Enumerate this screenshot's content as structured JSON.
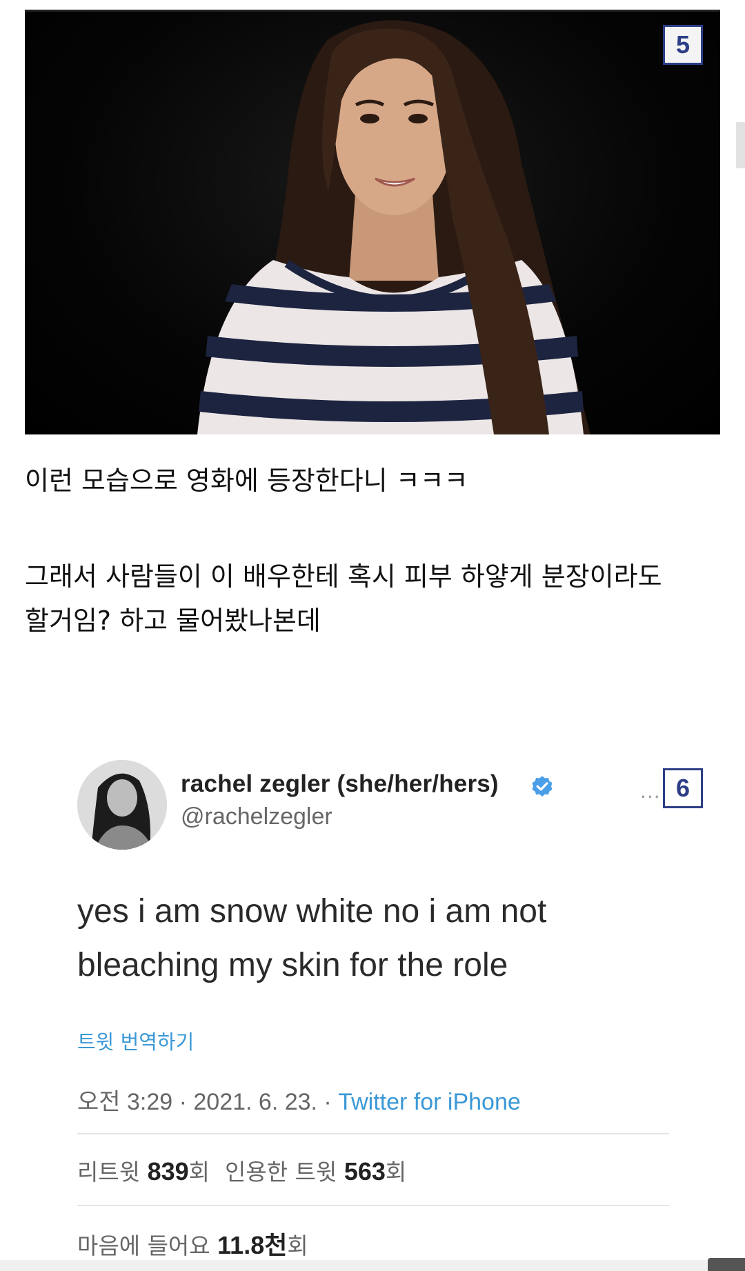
{
  "badges": {
    "first": "5",
    "second": "6"
  },
  "paragraphs": {
    "p1": "이런 모습으로 영화에 등장한다니 ㅋㅋㅋ",
    "p2_line1": "그래서 사람들이 이 배우한테 혹시 피부 하얗게 분장이라도",
    "p2_line2": "할거임? 하고 물어봤나본데"
  },
  "tweet": {
    "display_name": "rachel zegler (she/her/hers)",
    "handle": "@rachelzegler",
    "more_glyph": "···",
    "text_line1": "yes i am snow white no i am not",
    "text_line2": "bleaching my skin for the role",
    "translate_label": "트윗 번역하기",
    "meta_time": "오전 3:29 · 2021. 6. 23. · ",
    "meta_source": "Twitter for iPhone",
    "retweets_label": "리트윗 ",
    "retweets_count": "839",
    "retweets_unit": "회",
    "quotes_label": "인용한 트윗 ",
    "quotes_count": "563",
    "quotes_unit": "회",
    "likes_label": "마음에 들어요 ",
    "likes_count": "11.8천",
    "likes_unit": "회"
  },
  "colors": {
    "badge_border": "#2d3e86",
    "link_blue": "#3a98d6",
    "verified_blue": "#4a9fe8"
  },
  "icons": {
    "verified": "verified-badge-icon",
    "more": "more-dots-icon"
  }
}
